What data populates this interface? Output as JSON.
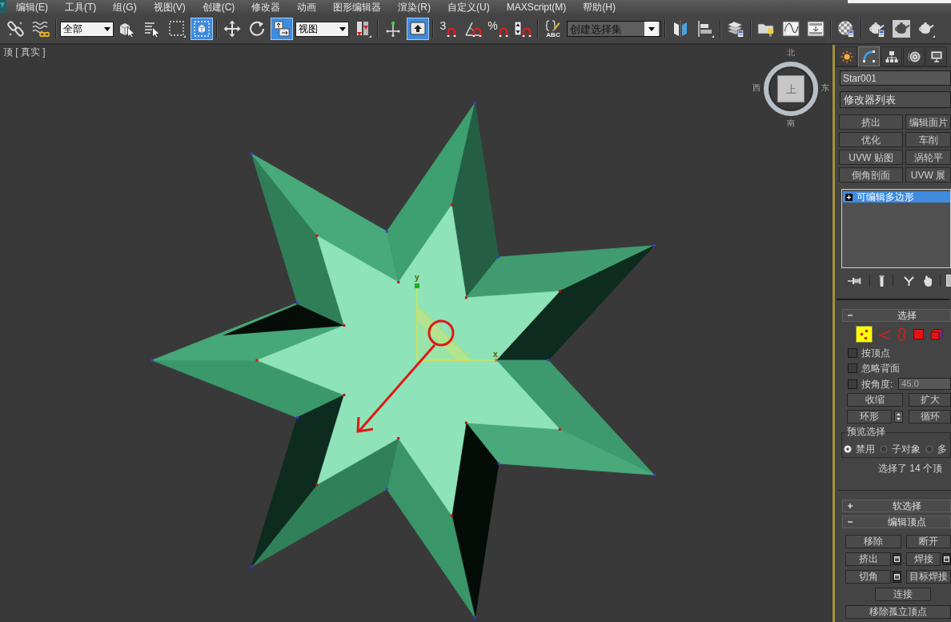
{
  "menu_bar": {
    "items": [
      "编辑(E)",
      "工具(T)",
      "组(G)",
      "视图(V)",
      "创建(C)",
      "修改器",
      "动画",
      "图形编辑器",
      "渲染(R)",
      "自定义(U)",
      "MAXScript(M)",
      "帮助(H)"
    ]
  },
  "toolbar": {
    "groups": [
      [
        {
          "kind": "tool",
          "active": false
        },
        {
          "kind": "tool",
          "active": false
        }
      ],
      [
        {
          "kind": "dropdown",
          "value": "全部"
        },
        {
          "kind": "tool",
          "active": false
        },
        {
          "kind": "tool",
          "active": false
        },
        {
          "kind": "tool",
          "active": false
        },
        {
          "kind": "tool",
          "active": true
        }
      ],
      [
        {
          "kind": "tool",
          "active": false
        },
        {
          "kind": "tool",
          "active": false
        },
        {
          "kind": "tool",
          "active": true
        },
        {
          "kind": "dropdown",
          "value": "视图"
        },
        {
          "kind": "tool",
          "active": false
        }
      ],
      [
        {
          "kind": "tool",
          "active": false
        },
        {
          "kind": "tool",
          "active": true
        }
      ],
      [
        {
          "kind": "tool",
          "active": false,
          "label": "3"
        },
        {
          "kind": "tool",
          "active": false
        },
        {
          "kind": "tool",
          "active": false,
          "label": "%"
        },
        {
          "kind": "tool",
          "active": false
        }
      ],
      [
        {
          "kind": "tool",
          "active": false,
          "label": "ABC"
        },
        {
          "kind": "combo",
          "placeholder": "创建选择集"
        }
      ],
      [
        {
          "kind": "tool",
          "active": false
        },
        {
          "kind": "tool",
          "active": false
        }
      ],
      [
        {
          "kind": "tool",
          "active": false
        }
      ],
      [
        {
          "kind": "tool",
          "active": false
        },
        {
          "kind": "tool",
          "active": false
        },
        {
          "kind": "tool",
          "active": false
        }
      ],
      [
        {
          "kind": "tool",
          "active": false
        }
      ],
      [
        {
          "kind": "tool",
          "active": false
        },
        {
          "kind": "tool",
          "active": false
        },
        {
          "kind": "tool",
          "active": false
        }
      ]
    ]
  },
  "viewport": {
    "label": "顶 [ 真实 ]",
    "view_cube": {
      "face": "上",
      "compass": [
        "北",
        "东",
        "南",
        "西"
      ]
    },
    "gizmo": {
      "axes": [
        {
          "label": "y"
        },
        {
          "label": "x"
        }
      ]
    }
  },
  "command_panel": {
    "tabs": [
      {
        "selected": false
      },
      {
        "selected": true
      },
      {
        "selected": false
      },
      {
        "selected": false
      },
      {
        "selected": false
      }
    ],
    "object_name": "Star001",
    "modifier_list": "修改器列表",
    "modifier_buttons": [
      "挤出",
      "编辑面片",
      "优化",
      "车削",
      "UVW 贴图",
      "涡轮平",
      "倒角剖面",
      "UVW 展"
    ],
    "stack": [
      {
        "label": "可编辑多边形",
        "selected": true,
        "expanded": false
      }
    ],
    "rollouts": [
      {
        "kind": "selection",
        "title": "选择",
        "expanded": true,
        "sub_objects": [
          {
            "selected": true
          },
          {
            "selected": false
          },
          {
            "selected": false
          },
          {
            "selected": false
          },
          {
            "selected": false
          }
        ],
        "checkboxes": [
          {
            "label": "按顶点",
            "checked": false
          },
          {
            "label": "忽略背面",
            "checked": false
          },
          {
            "label": "按角度:",
            "checked": false,
            "field": {
              "value": "45.0",
              "disabled": true
            }
          }
        ],
        "button_rows": [
          [
            {
              "kind": "button",
              "label": "收缩"
            },
            {
              "kind": "button",
              "label": "扩大"
            }
          ],
          [
            {
              "kind": "spinner",
              "label": "环形"
            },
            {
              "kind": "button",
              "label": "循环"
            }
          ]
        ],
        "preview": {
          "title": "预览选择",
          "options": [
            {
              "label": "禁用",
              "selected": true
            },
            {
              "label": "子对象",
              "selected": false
            },
            {
              "label": "多",
              "selected": false
            }
          ]
        },
        "status": "选择了 14 个顶"
      },
      {
        "kind": "soft_selection",
        "title": "软选择",
        "expanded": false
      },
      {
        "kind": "edit_vertices",
        "title": "编辑顶点",
        "expanded": true,
        "button_rows": [
          [
            {
              "kind": "button",
              "label": "移除"
            },
            {
              "kind": "button",
              "label": "断开"
            }
          ],
          [
            {
              "kind": "settings",
              "label": "挤出"
            },
            {
              "kind": "settings",
              "label": "焊接"
            }
          ],
          [
            {
              "kind": "settings",
              "label": "切角"
            },
            {
              "kind": "button",
              "label": "目标焊接"
            }
          ],
          [
            {
              "kind": "center",
              "label": "连接"
            }
          ],
          [
            {
              "kind": "wide",
              "label": "移除孤立顶点"
            }
          ]
        ]
      }
    ]
  }
}
